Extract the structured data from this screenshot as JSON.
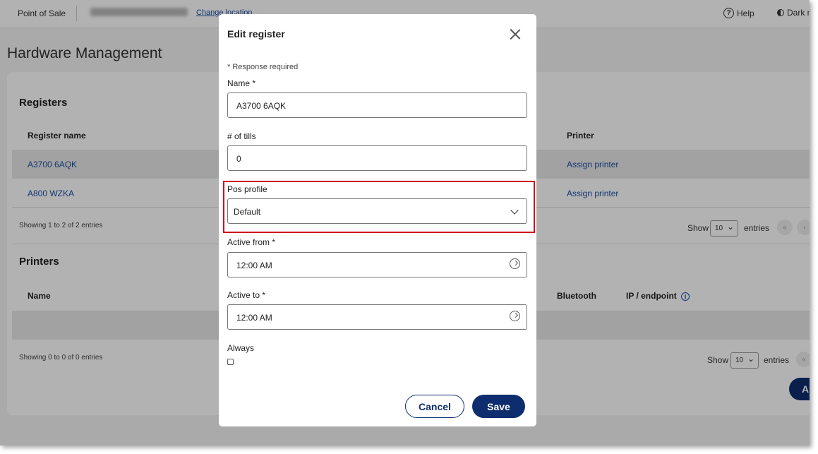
{
  "topbar": {
    "app_name": "Point of Sale",
    "change_location": "Change location",
    "help": "Help",
    "dark_mode": "Dark m"
  },
  "page": {
    "title": "Hardware Management"
  },
  "registers": {
    "title": "Registers",
    "columns": {
      "name": "Register name",
      "printer": "Printer"
    },
    "rows": [
      {
        "name": "A3700 6AQK",
        "printer": "Assign printer"
      },
      {
        "name": "A800 WZKA",
        "printer": "Assign printer"
      }
    ],
    "footer": "Showing 1 to 2 of 2 entries",
    "show": "Show",
    "entries_value": "10",
    "entries": "entries"
  },
  "printers": {
    "title": "Printers",
    "columns": {
      "name": "Name",
      "bluetooth": "Bluetooth",
      "ip": "IP / endpoint"
    },
    "footer": "Showing 0 to 0 of 0 entries",
    "show": "Show",
    "entries_value": "10",
    "entries": "entries",
    "add_button": "A"
  },
  "modal": {
    "title": "Edit register",
    "required_note": "* Response required",
    "name_label": "Name *",
    "name_value": "A3700 6AQK",
    "tills_label": "# of tills",
    "tills_value": "0",
    "pos_label": "Pos profile",
    "pos_value": "Default",
    "active_from_label": "Active from *",
    "active_from_value": "12:00 AM",
    "active_to_label": "Active to *",
    "active_to_value": "12:00 AM",
    "always_label": "Always",
    "cancel": "Cancel",
    "save": "Save"
  },
  "colors": {
    "primary": "#0e2d6e",
    "link": "#1b4ea3",
    "highlight": "#d0121b"
  }
}
